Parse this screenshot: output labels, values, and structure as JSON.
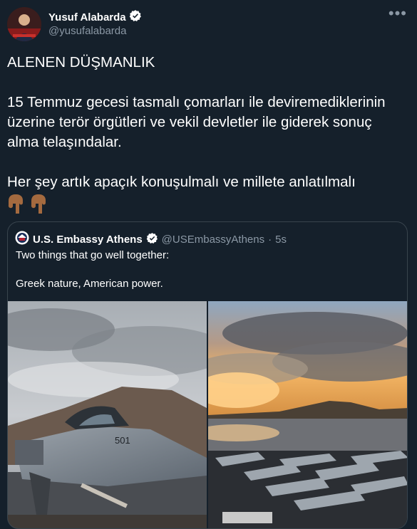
{
  "author": {
    "name": "Yusuf Alabarda",
    "handle": "@yusufalabarda",
    "verified_icon": "verified-badge-icon",
    "avatar_icon": "avatar"
  },
  "more_icon": "more-options-icon",
  "tweet": {
    "text": "ALENEN DÜŞMANLIK\n\n15 Temmuz gecesi tasmalı çomarları ile deviremediklerinin üzerine terör örgütleri ve vekil devletler ile giderek sonuç alma telaşındalar.\n\nHer şey artık apaçık konuşulmalı ve millete anlatılmalı",
    "emojis": [
      "👇🏽",
      "👇🏽"
    ]
  },
  "quoted": {
    "name": "U.S. Embassy Athens",
    "handle": "@USEmbassyAthens",
    "separator": "·",
    "time": "5s",
    "text": "Two things that go well together:\n\nGreek nature, American power.",
    "images": [
      "fighter-jet-photo",
      "aircraft-carrier-sunset-photo"
    ]
  },
  "colors": {
    "background": "#15202b",
    "secondary_text": "#8b98a5",
    "border": "#38444d",
    "verified": "#ffffff"
  }
}
